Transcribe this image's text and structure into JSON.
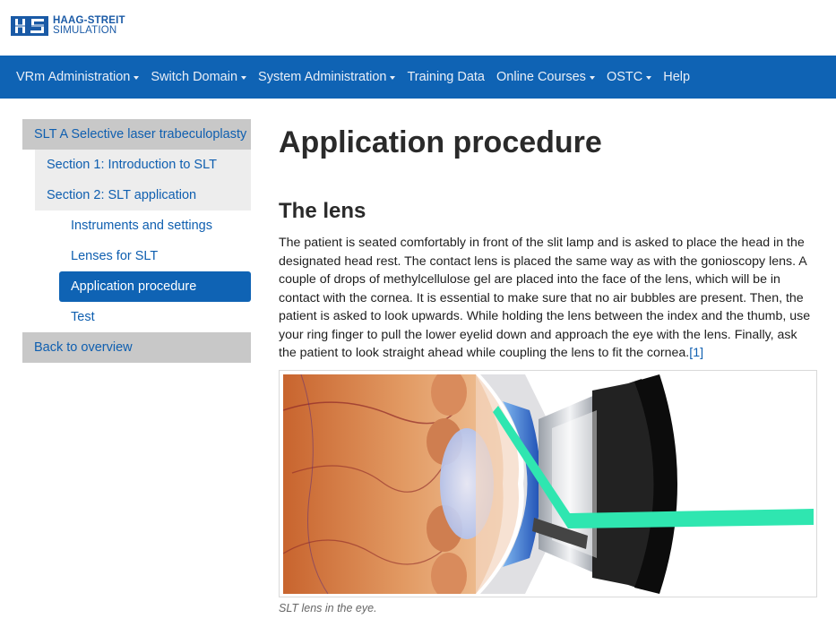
{
  "brand": {
    "line1": "HAAG-STREIT",
    "line2": "SIMULATION"
  },
  "nav": {
    "items": [
      {
        "label": "VRm Administration",
        "dropdown": true
      },
      {
        "label": "Switch Domain",
        "dropdown": true
      },
      {
        "label": "System Administration",
        "dropdown": true
      },
      {
        "label": "Training Data",
        "dropdown": false
      },
      {
        "label": "Online Courses",
        "dropdown": true
      },
      {
        "label": "OSTC",
        "dropdown": true
      },
      {
        "label": "Help",
        "dropdown": false
      }
    ]
  },
  "sidebar": {
    "course": "SLT A Selective laser trabeculoplasty",
    "section1": "Section 1: Introduction to SLT",
    "section2": "Section 2: SLT application",
    "sub": {
      "instruments": "Instruments and settings",
      "lenses": "Lenses for SLT",
      "application": "Application procedure",
      "test": "Test"
    },
    "back": "Back to overview"
  },
  "main": {
    "title": "Application procedure",
    "section_title": "The lens",
    "paragraph": "The patient is seated comfortably in front of the slit lamp and is asked to place the head in the designated head rest. The contact lens is placed the same way as with the gonioscopy lens. A couple of drops of methylcellulose gel are placed into the face of the lens, which will be in contact with the cornea. It is essential to make sure that no air bubbles are present. Then, the patient is asked to look upwards. While holding the lens between the index and the thumb, use your ring finger to pull the lower eyelid down and approach the eye with the lens. Finally, ask the patient to look straight ahead while coupling the lens to fit the cornea.",
    "reference": "[1]",
    "caption": "SLT lens in the eye."
  },
  "colors": {
    "navbar": "#0f63b4",
    "link": "#0f5fb0",
    "active": "#0f63b4",
    "sidebar_gray": "#c8c8c8",
    "laser": "#2fe6b0"
  }
}
